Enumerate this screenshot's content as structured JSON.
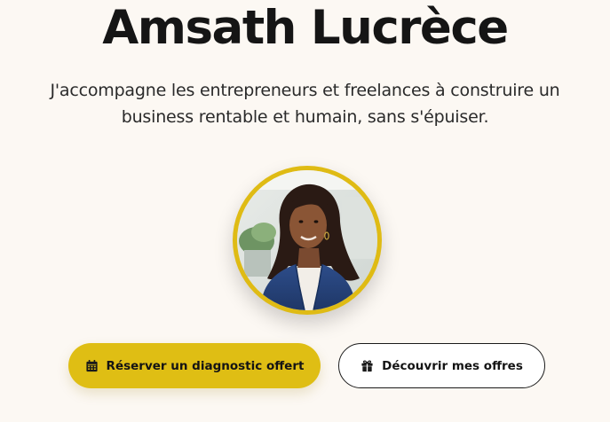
{
  "hero": {
    "title": "Amsath Lucrèce",
    "subtitle": "J'accompagne les entrepreneurs et freelances à construire un business rentable et humain, sans s'épuiser."
  },
  "avatar": {
    "alt": "Amsath Lucrèce"
  },
  "cta": {
    "primary_label": "Réserver un diagnostic offert",
    "primary_icon": "calendar-icon",
    "secondary_label": "Découvrir mes offres",
    "secondary_icon": "gift-icon"
  },
  "colors": {
    "background": "#fcf8f3",
    "accent": "#dfbe14",
    "text": "#151515"
  }
}
